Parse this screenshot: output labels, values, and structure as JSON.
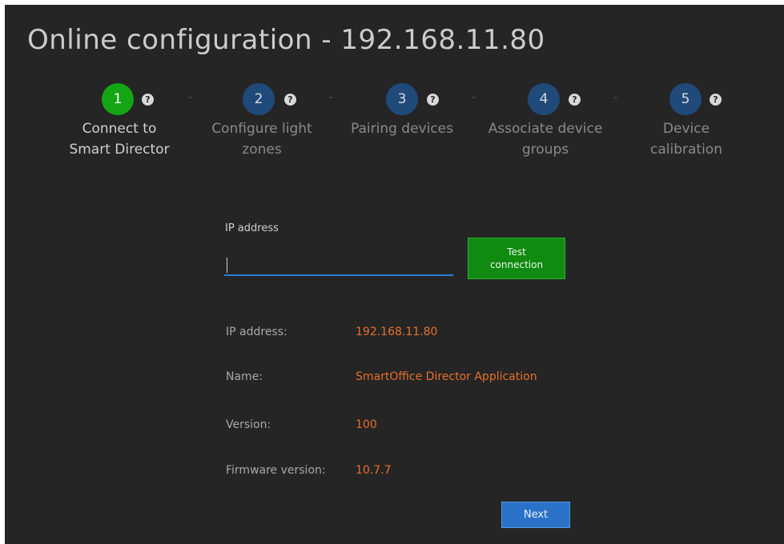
{
  "page": {
    "title": "Online configuration - 192.168.11.80"
  },
  "wizard": {
    "separator": "-",
    "help_glyph": "?",
    "steps": [
      {
        "number": "1",
        "label_line1": "Connect to",
        "label_line2": "Smart Director",
        "state": "active"
      },
      {
        "number": "2",
        "label_line1": "Configure light",
        "label_line2": "zones",
        "state": "inactive"
      },
      {
        "number": "3",
        "label_line1": "Pairing devices",
        "label_line2": "",
        "state": "inactive"
      },
      {
        "number": "4",
        "label_line1": "Associate device",
        "label_line2": "groups",
        "state": "inactive"
      },
      {
        "number": "5",
        "label_line1": "Device",
        "label_line2": "calibration",
        "state": "inactive"
      }
    ]
  },
  "connection": {
    "ip_label": "IP address",
    "ip_value": "",
    "test_button_line1": "Test",
    "test_button_line2": "connection"
  },
  "info": {
    "rows": [
      {
        "label": "IP address:",
        "value": "192.168.11.80"
      },
      {
        "label": "Name:",
        "value": "SmartOffice Director Application"
      },
      {
        "label": "Version:",
        "value": "100"
      },
      {
        "label": "Firmware version:",
        "value": "10.7.7"
      }
    ]
  },
  "footer": {
    "next_label": "Next"
  },
  "colors": {
    "background": "#252525",
    "active_step": "#14a514",
    "inactive_step": "#1f4a7a",
    "value_text": "#e8702a",
    "test_button": "#108a10",
    "next_button": "#2a72c8",
    "input_underline": "#2a7fd4"
  }
}
